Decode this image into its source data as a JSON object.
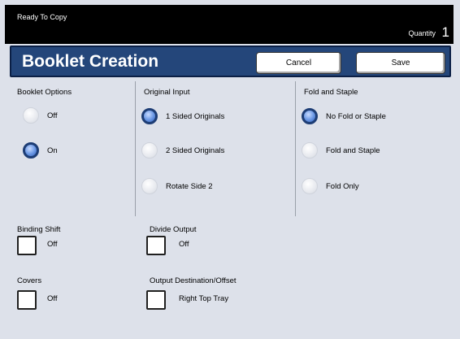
{
  "status": "Ready To Copy",
  "quantity": {
    "label": "Quantity",
    "value": "1"
  },
  "header": {
    "title": "Booklet Creation",
    "cancel": "Cancel",
    "save": "Save"
  },
  "booklet_options": {
    "label": "Booklet Options",
    "options": [
      {
        "label": "Off",
        "selected": false
      },
      {
        "label": "On",
        "selected": true
      }
    ]
  },
  "original_input": {
    "label": "Original Input",
    "options": [
      {
        "label": "1 Sided Originals",
        "selected": true
      },
      {
        "label": "2 Sided Originals",
        "selected": false
      },
      {
        "label": "Rotate Side 2",
        "selected": false
      }
    ]
  },
  "fold_staple": {
    "label": "Fold and Staple",
    "options": [
      {
        "label": "No Fold or Staple",
        "selected": true
      },
      {
        "label": "Fold and Staple",
        "selected": false
      },
      {
        "label": "Fold Only",
        "selected": false
      }
    ]
  },
  "binding_shift": {
    "label": "Binding Shift",
    "value": "Off"
  },
  "divide_output": {
    "label": "Divide Output",
    "value": "Off"
  },
  "covers": {
    "label": "Covers",
    "value": "Off"
  },
  "output_destination": {
    "label": "Output Destination/Offset",
    "value": "Right Top Tray"
  }
}
